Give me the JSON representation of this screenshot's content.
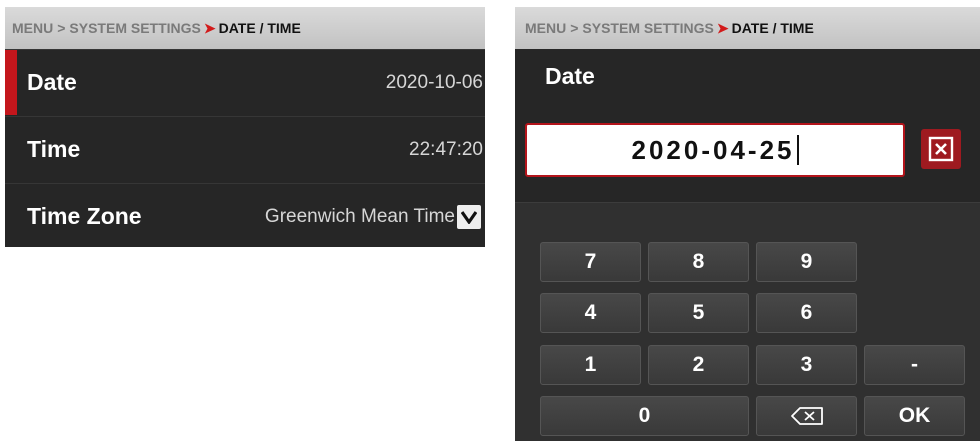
{
  "left_panel": {
    "breadcrumb": {
      "root": "MENU",
      "sep": ">",
      "section": "SYSTEM SETTINGS",
      "current": "DATE / TIME"
    },
    "rows": [
      {
        "label": "Date",
        "value": "2020-10-06",
        "selected": true
      },
      {
        "label": "Time",
        "value": "22:47:20"
      },
      {
        "label": "Time Zone",
        "value": "Greenwich Mean Time",
        "control": "dropdown-chevron"
      }
    ]
  },
  "right_panel": {
    "breadcrumb": {
      "root": "MENU",
      "sep": ">",
      "section": "SYSTEM SETTINGS",
      "current": "DATE / TIME"
    },
    "dialog_title": "Date",
    "date_input_value": "2020-04-25",
    "clear_icon": "close-box-icon",
    "keypad": {
      "keys": [
        "7",
        "8",
        "9",
        "4",
        "5",
        "6",
        "1",
        "2",
        "3",
        "-",
        "0",
        "OK"
      ],
      "backspace_icon": "backspace-icon"
    }
  },
  "colors": {
    "accent_red": "#c4161c",
    "panel_bg": "#262626",
    "breadcrumb_bg": "#cfcfcf",
    "key_bg": "#434343"
  }
}
